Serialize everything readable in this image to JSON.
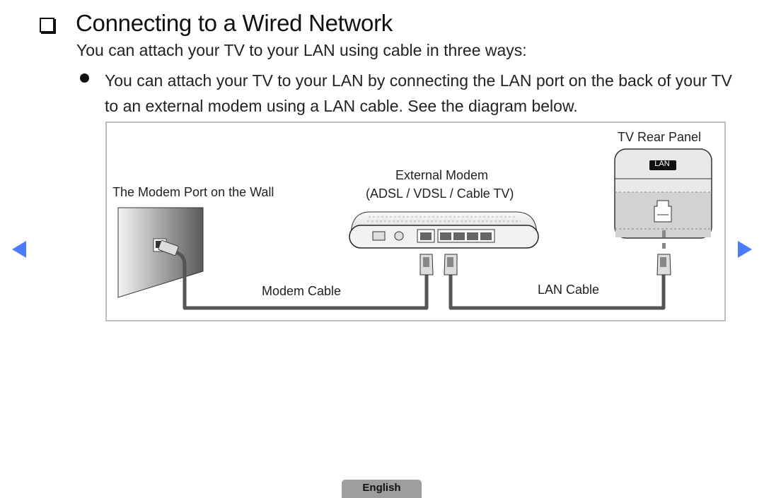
{
  "header": {
    "title": "Connecting to a Wired Network",
    "icon": "checkbox-icon"
  },
  "content": {
    "intro": "You can attach your TV to your LAN using cable in three ways:",
    "bullets": [
      "You can attach your TV to your LAN by connecting the LAN port on the back of your TV to an external modem using a LAN cable. See the diagram below."
    ]
  },
  "diagram": {
    "wall_port_label": "The Modem Port on the Wall",
    "modem_label_line1": "External Modem",
    "modem_label_line2": "(ADSL / VDSL / Cable TV)",
    "tv_panel_label": "TV Rear Panel",
    "lan_badge": "LAN",
    "modem_cable_label": "Modem Cable",
    "lan_cable_label": "LAN Cable"
  },
  "navigation": {
    "prev_icon": "triangle-left-icon",
    "next_icon": "triangle-right-icon",
    "accent_color": "#4c7bff"
  },
  "footer": {
    "language": "English"
  }
}
